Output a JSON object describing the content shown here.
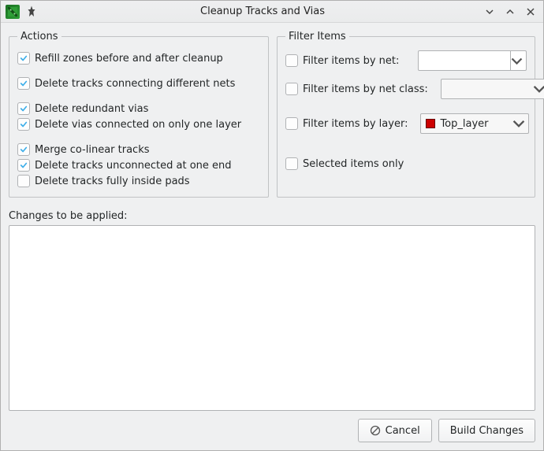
{
  "window": {
    "title": "Cleanup Tracks and Vias"
  },
  "actions": {
    "legend": "Actions",
    "items": [
      {
        "label": "Refill zones before and after cleanup",
        "checked": true,
        "spaced": false
      },
      {
        "label": "Delete tracks connecting different nets",
        "checked": true,
        "spaced": true
      },
      {
        "label": "Delete redundant vias",
        "checked": true,
        "spaced": true
      },
      {
        "label": "Delete vias connected on only one layer",
        "checked": true,
        "spaced": false
      },
      {
        "label": "Merge co-linear tracks",
        "checked": true,
        "spaced": true
      },
      {
        "label": "Delete tracks unconnected at one end",
        "checked": true,
        "spaced": false
      },
      {
        "label": "Delete tracks fully inside pads",
        "checked": false,
        "spaced": false
      }
    ]
  },
  "filter": {
    "legend": "Filter Items",
    "byNet": {
      "label": "Filter items by net:",
      "checked": false,
      "value": ""
    },
    "byNetClass": {
      "label": "Filter items by net class:",
      "checked": false,
      "value": ""
    },
    "byLayer": {
      "label": "Filter items by layer:",
      "checked": false,
      "value": "Top_layer"
    },
    "selectedOnly": {
      "label": "Selected items only",
      "checked": false
    }
  },
  "changes": {
    "label": "Changes to be applied:"
  },
  "buttons": {
    "cancel": "Cancel",
    "build": "Build Changes"
  }
}
